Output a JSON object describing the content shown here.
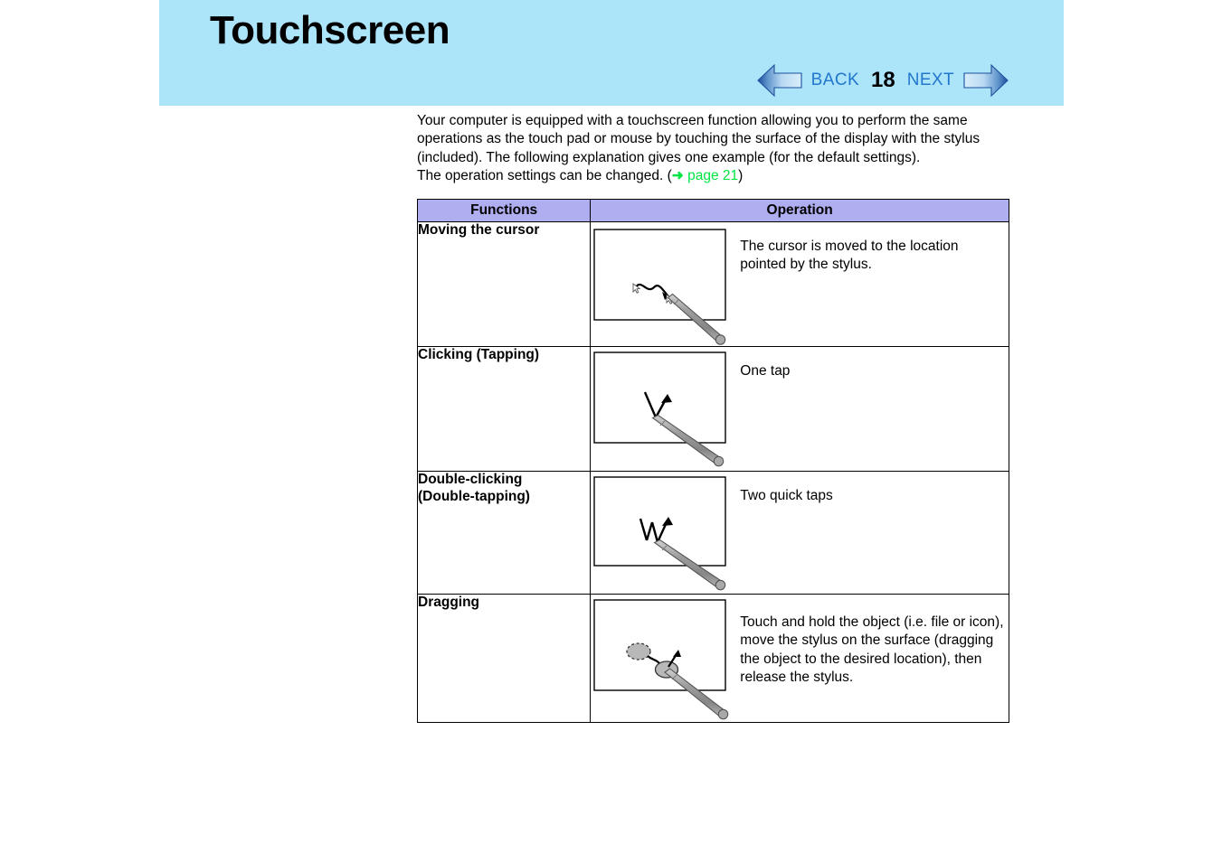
{
  "header": {
    "title": "Touchscreen",
    "background_color": "#ace4fa"
  },
  "pager": {
    "back_label": "BACK",
    "page_number": "18",
    "next_label": "NEXT",
    "back_icon": "left-arrow-icon",
    "next_icon": "right-arrow-icon",
    "link_color": "#2277cc"
  },
  "intro": {
    "line1": "Your computer is equipped with a touchscreen function allowing you to perform the same operations as the touch pad or mouse by touching the surface of the display with the stylus (included).   The following explanation gives one example (for the default settings).",
    "line2_prefix": "The operation settings can be changed. (",
    "link_arrow": "➜",
    "link_text": "page 21",
    "line2_suffix": ")",
    "link_color": "#00e544"
  },
  "table": {
    "header_background": "#aeaef0",
    "columns": [
      "Functions",
      "Operation"
    ],
    "rows": [
      {
        "function": "Moving the cursor",
        "figure": "cursor-move-illustration",
        "description": "The cursor is moved to the location pointed by the stylus."
      },
      {
        "function": "Clicking (Tapping)",
        "figure": "single-tap-illustration",
        "description": "One tap"
      },
      {
        "function": "Double-clicking (Double-tapping)",
        "function_line1": "Double-clicking",
        "function_line2": "(Double-tapping)",
        "figure": "double-tap-illustration",
        "description": "Two quick taps"
      },
      {
        "function": "Dragging",
        "figure": "drag-illustration",
        "description": "Touch and hold the object (i.e. file or icon), move the stylus on the surface (dragging the object to the desired location), then release the stylus."
      }
    ]
  }
}
